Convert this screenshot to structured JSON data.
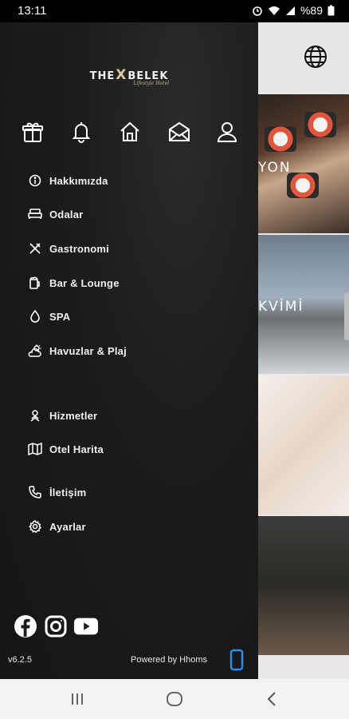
{
  "status_bar": {
    "time": "13:11",
    "battery": "%89"
  },
  "brand": {
    "logo_text_left": "THE",
    "logo_text_x": "X",
    "logo_text_right": "BELEK",
    "logo_subtitle": "Lifestyle Hotel"
  },
  "quick_actions": [
    {
      "icon": "gift-icon"
    },
    {
      "icon": "bell-icon"
    },
    {
      "icon": "home-icon"
    },
    {
      "icon": "mail-icon"
    },
    {
      "icon": "user-icon"
    }
  ],
  "menu": {
    "items": [
      {
        "label": "Hakkımızda",
        "icon": "info-icon"
      },
      {
        "label": "Odalar",
        "icon": "bed-icon"
      },
      {
        "label": "Gastronomi",
        "icon": "utensils-icon"
      },
      {
        "label": "Bar & Lounge",
        "icon": "beer-icon"
      },
      {
        "label": "SPA",
        "icon": "drop-icon"
      },
      {
        "label": "Havuzlar & Plaj",
        "icon": "sun-cloud-icon"
      },
      {
        "label": "Hizmetler",
        "icon": "concierge-icon"
      },
      {
        "label": "Otel Harita",
        "icon": "map-icon"
      },
      {
        "label": "İletişim",
        "icon": "phone-icon"
      },
      {
        "label": "Ayarlar",
        "icon": "settings-icon"
      }
    ]
  },
  "social": [
    {
      "icon": "facebook-icon"
    },
    {
      "icon": "instagram-icon"
    },
    {
      "icon": "youtube-icon"
    }
  ],
  "footer": {
    "version": "v6.2.5",
    "powered_by": "Powered by Hhoms"
  },
  "background_cards": [
    {
      "label": "YON"
    },
    {
      "label": "KVİMİ"
    }
  ],
  "colors": {
    "drawer_bg": "#1c1c1c",
    "accent_gold": "#d9c7a3",
    "hhoms_blue": "#1e90ff"
  }
}
